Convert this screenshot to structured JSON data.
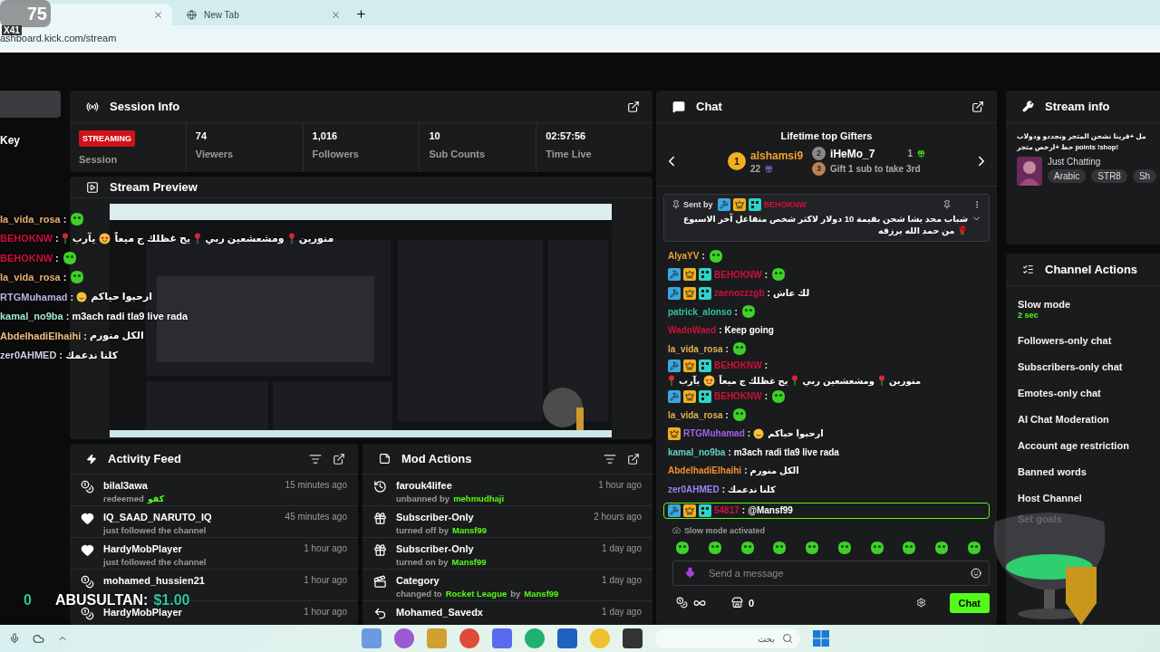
{
  "browser": {
    "tabs": [
      {
        "selected": true
      },
      {
        "title": "New Tab",
        "selected": false
      }
    ],
    "address": "ashboard.kick.com/stream"
  },
  "sidebar": {
    "items": [
      {
        "selected": true
      },
      {
        "label": "Key",
        "selected": false
      }
    ]
  },
  "session_info": {
    "title": "Session Info",
    "status": "STREAMING",
    "status_label": "Session",
    "stats": [
      {
        "value": "74",
        "label": "Viewers"
      },
      {
        "value": "1,016",
        "label": "Followers"
      },
      {
        "value": "10",
        "label": "Sub Counts"
      },
      {
        "value": "02:57:56",
        "label": "Time Live"
      }
    ]
  },
  "stream_preview": {
    "title": "Stream Preview"
  },
  "activity_feed": {
    "title": "Activity Feed",
    "items": [
      {
        "kind": "redeem",
        "name": "bilal3awa",
        "detail": [
          {
            "text": "redeemed",
            "accent": false
          },
          {
            "text": "كفو",
            "accent": true
          }
        ],
        "time": "15 minutes ago"
      },
      {
        "kind": "follow",
        "name": "IQ_SAAD_NARUTO_IQ",
        "detail": [
          {
            "text": "just followed the channel",
            "accent": false
          }
        ],
        "time": "45 minutes ago"
      },
      {
        "kind": "follow",
        "name": "HardyMobPlayer",
        "detail": [
          {
            "text": "just followed the channel",
            "accent": false
          }
        ],
        "time": "1 hour ago"
      },
      {
        "kind": "redeem",
        "name": "mohamed_hussien21",
        "time": "1 hour ago"
      },
      {
        "kind": "redeem",
        "name": "HardyMobPlayer",
        "time": "1 hour ago"
      }
    ]
  },
  "mod_actions": {
    "title": "Mod Actions",
    "items": [
      {
        "kind": "unban",
        "name": "farouk4lifee",
        "detail": [
          {
            "text": "unbanned by",
            "accent": false
          },
          {
            "text": "mehmudhaji",
            "accent": true
          }
        ],
        "time": "1 hour ago"
      },
      {
        "kind": "gift",
        "name": "Subscriber-Only",
        "detail": [
          {
            "text": "turned off by",
            "accent": false
          },
          {
            "text": "Mansf99",
            "accent": true
          }
        ],
        "time": "2 hours ago"
      },
      {
        "kind": "gift",
        "name": "Subscriber-Only",
        "detail": [
          {
            "text": "turned on by",
            "accent": false
          },
          {
            "text": "Mansf99",
            "accent": true
          }
        ],
        "time": "1 day ago"
      },
      {
        "kind": "category",
        "name": "Category",
        "detail": [
          {
            "text": "changed to",
            "accent": false
          },
          {
            "text": "Rocket League",
            "accent": true
          },
          {
            "text": "by",
            "accent": false
          },
          {
            "text": "Mansf99",
            "accent": true
          }
        ],
        "time": "1 day ago"
      },
      {
        "kind": "undo",
        "name": "Mohamed_Savedx",
        "time": "1 day ago"
      }
    ]
  },
  "chat": {
    "title": "Chat",
    "gifters": {
      "title": "Lifetime top Gifters",
      "first": {
        "rank": "1",
        "name": "alshamsi9",
        "count": "22"
      },
      "second": {
        "rank": "2",
        "name": "iHeMo_7",
        "count": "1"
      },
      "third": {
        "rank": "3",
        "text": "Gift 1 sub to take 3rd"
      }
    },
    "pinned": {
      "label": "Sent by",
      "user": "BEHOKNW",
      "color": "#d0103a",
      "moderator": true,
      "vip": true,
      "og": true,
      "text": "شباب محد يشا شحن بقيمة 10 دولار لاكثر شخص متفاعل آخر الاسبوع 🌹 من حمد الله يرزقه"
    },
    "messages": [
      {
        "user": "AlyaYV",
        "sep": ":",
        "color": "#f0a030",
        "moderator": false,
        "vip": false,
        "og": false,
        "parts": [
          {
            "kind": "emote"
          }
        ],
        "highlighted": false
      },
      {
        "user": "BEHOKNW",
        "sep": ":",
        "color": "#d0103a",
        "moderator": true,
        "vip": true,
        "og": true,
        "parts": [
          {
            "kind": "emote"
          }
        ],
        "highlighted": false
      },
      {
        "user": "zaenozzzgb",
        "sep": ":",
        "color": "#d0103a",
        "moderator": true,
        "vip": true,
        "og": true,
        "parts": [
          {
            "kind": "text",
            "text": "لك عاش"
          }
        ],
        "highlighted": false
      },
      {
        "user": "patrick_alonso",
        "sep": ":",
        "color": "#2ec4a0",
        "moderator": false,
        "vip": false,
        "og": false,
        "parts": [
          {
            "kind": "emote"
          }
        ],
        "highlighted": false
      },
      {
        "user": "WadoWaed",
        "sep": ":",
        "color": "#d0103a",
        "moderator": false,
        "vip": false,
        "og": false,
        "parts": [
          {
            "kind": "text",
            "text": "Keep going"
          }
        ],
        "highlighted": false
      },
      {
        "user": "la_vida_rosa",
        "sep": ":",
        "color": "#e0b050",
        "moderator": false,
        "vip": false,
        "og": false,
        "parts": [
          {
            "kind": "emote"
          }
        ],
        "highlighted": false
      },
      {
        "user": "BEHOKNW",
        "sep": ":",
        "color": "#d0103a",
        "moderator": true,
        "vip": true,
        "og": true,
        "parts": [
          {
            "kind": "text",
            "text": "منورين"
          },
          {
            "kind": "rose"
          },
          {
            "kind": "text",
            "text": "ومشعشعين ربي"
          },
          {
            "kind": "rose"
          },
          {
            "kind": "text",
            "text": "يح غظلك ج ميعاً"
          },
          {
            "kind": "heart-eyes"
          },
          {
            "kind": "text",
            "text": "يآرب"
          },
          {
            "kind": "rose"
          }
        ],
        "highlighted": false
      },
      {
        "user": "BEHOKNW",
        "sep": ":",
        "color": "#d0103a",
        "moderator": true,
        "vip": true,
        "og": true,
        "parts": [
          {
            "kind": "emote"
          }
        ],
        "highlighted": false
      },
      {
        "user": "la_vida_rosa",
        "sep": ":",
        "color": "#e0b050",
        "moderator": false,
        "vip": false,
        "og": false,
        "parts": [
          {
            "kind": "emote"
          }
        ],
        "highlighted": false
      },
      {
        "user": "RTGMuhamad",
        "sep": ":",
        "color": "#a060f0",
        "moderator": false,
        "vip": true,
        "og": false,
        "parts": [
          {
            "kind": "text",
            "text": "ارحبوا حياكم"
          },
          {
            "kind": "smiley"
          }
        ],
        "highlighted": false
      },
      {
        "user": "kamal_no9ba",
        "sep": ":",
        "color": "#5fd3c0",
        "moderator": false,
        "vip": false,
        "og": false,
        "parts": [
          {
            "kind": "text",
            "text": "m3ach radi tla9 live rada"
          }
        ],
        "highlighted": false
      },
      {
        "user": "AbdelhadiElhaihi",
        "sep": ":",
        "color": "#f09030",
        "moderator": false,
        "vip": false,
        "og": false,
        "parts": [
          {
            "kind": "text",
            "text": "الكل منورم"
          }
        ],
        "highlighted": false
      },
      {
        "user": "zer0AHMED",
        "sep": ":",
        "color": "#a080f0",
        "moderator": false,
        "vip": false,
        "og": false,
        "parts": [
          {
            "kind": "text",
            "text": "كلنا ندعمك"
          }
        ],
        "highlighted": false
      },
      {
        "user": "54817",
        "sep": ":",
        "color": "#d0103a",
        "moderator": true,
        "vip": true,
        "og": true,
        "parts": [
          {
            "kind": "text",
            "text": "@Mansf99"
          }
        ],
        "highlighted": true
      }
    ],
    "notice": "Slow mode activated",
    "input": {
      "placeholder": "Send a message"
    },
    "store_count": "0",
    "send_button": "Chat"
  },
  "stream_info": {
    "title": "Stream info",
    "title_lines": [
      "مل +قرينا نشحن المتجر ونجددو ودولاب",
      "!points !shop حظ +ارخص متجر"
    ],
    "category": "Just Chatting",
    "tags": [
      "Arabic",
      "STR8",
      "Sh"
    ]
  },
  "channel_actions": {
    "title": "Channel Actions",
    "items": [
      {
        "label": "Slow mode",
        "value": "2 sec",
        "disabled": false
      },
      {
        "label": "Followers-only chat",
        "disabled": false
      },
      {
        "label": "Subscribers-only chat",
        "disabled": false
      },
      {
        "label": "Emotes-only chat",
        "disabled": false
      },
      {
        "label": "AI Chat Moderation",
        "disabled": false
      },
      {
        "label": "Account age restriction",
        "disabled": false
      },
      {
        "label": "Banned words",
        "disabled": false
      },
      {
        "label": "Host Channel",
        "disabled": false
      },
      {
        "label": "Set goals",
        "disabled": true
      }
    ]
  },
  "stream_overlay": {
    "counter": "75",
    "counter_sub": "X41",
    "chat": [
      {
        "user": "la_vida_rosa",
        "sep": " :",
        "color": "#e8b070",
        "parts": [
          {
            "kind": "emote"
          }
        ]
      },
      {
        "user": "BEHOKNW",
        "sep": " :",
        "color": "#d01040",
        "parts": [
          {
            "kind": "text",
            "text": "منورين"
          },
          {
            "kind": "rose"
          },
          {
            "kind": "text",
            "text": "ومشعشعين ربي"
          },
          {
            "kind": "rose"
          },
          {
            "kind": "text",
            "text": "يح غظلك ج ميعاً"
          },
          {
            "kind": "heart-eyes"
          },
          {
            "kind": "text",
            "text": "يآرب"
          },
          {
            "kind": "rose"
          }
        ]
      },
      {
        "user": "BEHOKNW",
        "sep": " :",
        "color": "#d01040",
        "parts": [
          {
            "kind": "emote"
          }
        ]
      },
      {
        "user": "la_vida_rosa",
        "sep": " :",
        "color": "#e8b070",
        "parts": [
          {
            "kind": "emote"
          }
        ]
      },
      {
        "user": "RTGMuhamad",
        "sep": " :",
        "color": "#c0b0e0",
        "parts": [
          {
            "kind": "text",
            "text": "ارحبوا حياكم"
          },
          {
            "kind": "smiley"
          }
        ]
      },
      {
        "user": "kamal_no9ba",
        "sep": " :",
        "color": "#a0e8d8",
        "parts": [
          {
            "kind": "text",
            "text": "m3ach radi tla9 live rada"
          }
        ]
      },
      {
        "user": "AbdelhadiElhaihi",
        "sep": " :",
        "color": "#f0c080",
        "parts": [
          {
            "kind": "text",
            "text": "الكل منورم"
          }
        ]
      },
      {
        "user": "zer0AHMED",
        "sep": " :",
        "color": "#d0d0e0",
        "parts": [
          {
            "kind": "text",
            "text": "كلنا ندعمك"
          }
        ]
      }
    ],
    "donation": {
      "edge": "0",
      "name": "ABUSULTAN:",
      "amount": "$1.00"
    }
  },
  "taskbar": {
    "search_placeholder": "بحث"
  }
}
